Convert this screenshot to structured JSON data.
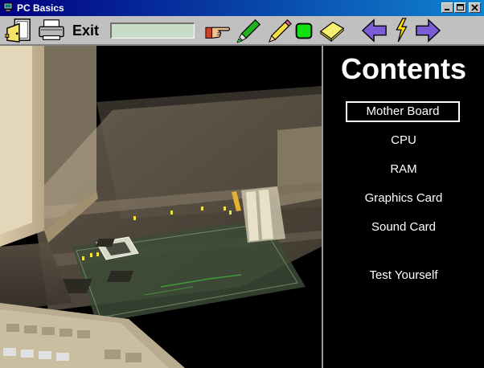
{
  "window": {
    "title": "PC Basics"
  },
  "toolbar": {
    "exit_label": "Exit",
    "page_field_value": "",
    "icons": [
      "exit-door-icon",
      "printer-icon",
      "pointing-hand-icon",
      "highlighter-icon",
      "pencil-eraser-icon",
      "green-square-icon",
      "sticky-note-icon",
      "back-arrow-icon",
      "lightning-icon",
      "forward-arrow-icon"
    ]
  },
  "contents": {
    "title": "Contents",
    "items": [
      {
        "label": "Mother Board",
        "selected": true
      },
      {
        "label": "CPU"
      },
      {
        "label": "RAM"
      },
      {
        "label": "Graphics Card"
      },
      {
        "label": "Sound Card"
      },
      {
        "label": "Test Yourself"
      }
    ]
  },
  "colors": {
    "title_bar_start": "#000080",
    "title_bar_end": "#1084d0",
    "toolbar_bg": "#c0c0c0",
    "contents_bg": "#000000",
    "contents_text": "#ffffff",
    "arrow_purple": "#7b5cd6",
    "lightning_yellow": "#ffe400"
  }
}
